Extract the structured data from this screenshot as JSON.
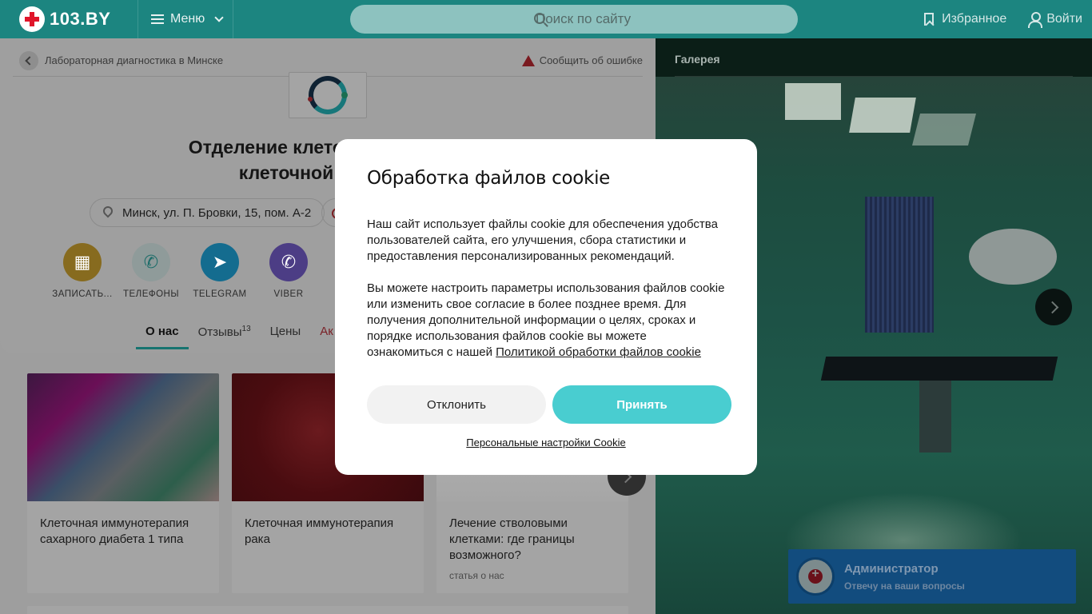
{
  "header": {
    "logo_text": "103.BY",
    "menu_label": "Меню",
    "search_placeholder": "Поиск по сайту",
    "favorites_label": "Избранное",
    "login_label": "Войти"
  },
  "breadcrumb": {
    "label": "Лабораторная диагностика в Минске",
    "report_label": "Сообщить об ошибке"
  },
  "clinic": {
    "title_line1": "Отделение клеточной терапии",
    "title_line2": "клеточной инженер",
    "address": "Минск, ул. П. Бровки, 15, пом. А-2"
  },
  "actions": [
    {
      "label": "ЗАПИСАТЬ...",
      "color": "#876b1f",
      "icon": "calendar-icon"
    },
    {
      "label": "ТЕЛЕФОНЫ",
      "color": "#8f9b9a",
      "icon": "phone-icon"
    },
    {
      "label": "TELEGRAM",
      "color": "#146c8f",
      "icon": "telegram-icon"
    },
    {
      "label": "VIBER",
      "color": "#4c3d85",
      "icon": "viber-icon"
    }
  ],
  "tabs": [
    {
      "label": "О нас",
      "count": ""
    },
    {
      "label": "Отзывы",
      "count": "13"
    },
    {
      "label": "Цены",
      "count": ""
    },
    {
      "label": "Ак",
      "count": ""
    }
  ],
  "articles": [
    {
      "title": "Клеточная иммунотерапия сахарного диабета 1 типа",
      "tag": ""
    },
    {
      "title": "Клеточная иммунотерапия рака",
      "tag": ""
    },
    {
      "title": "Лечение стволовыми клетками: где границы возможного?",
      "tag": "статья о нас"
    }
  ],
  "gallery": {
    "label": "Галерея"
  },
  "chat": {
    "title": "Администратор",
    "subtitle": "Отвечу на ваши вопросы"
  },
  "cookie": {
    "title": "Обработка файлов cookie",
    "paragraph1": "Наш сайт использует файлы cookie для обеспечения удобства пользователей сайта, его улучшения, сбора статистики и предоставления персонализированных рекомендаций.",
    "paragraph2": "Вы можете настроить параметры использования файлов cookie или изменить свое согласие в более позднее время. Для получения дополнительной информации о целях, сроках и порядке использования файлов cookie вы можете ознакомиться с нашей",
    "policy_link": "Политикой обработки файлов cookie",
    "decline_label": "Отклонить",
    "accept_label": "Принять",
    "settings_link": "Персональные настройки Cookie"
  },
  "colors": {
    "header_bg": "#1c8580",
    "accept_button": "#49cdd0",
    "chat_bg": "#124c7e"
  }
}
